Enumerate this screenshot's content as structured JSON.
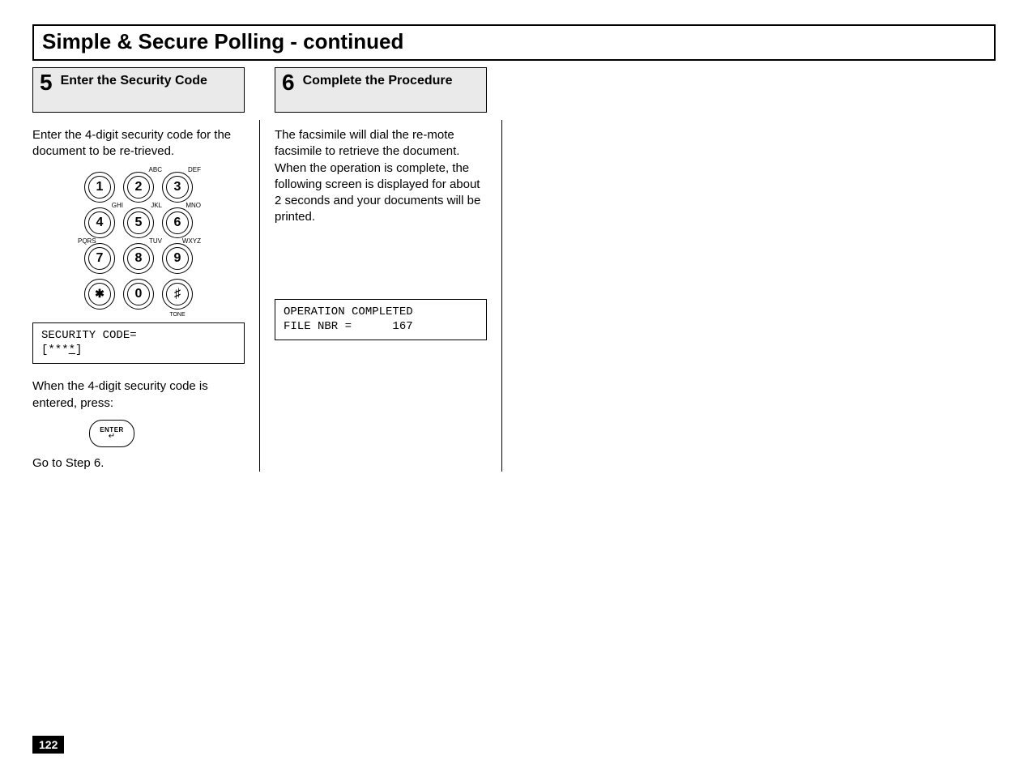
{
  "title": "Simple & Secure Polling - continued",
  "step5": {
    "num": "5",
    "title": "Enter the Security Code",
    "body1": "Enter the 4-digit security code for the document to be re-trieved.",
    "lcd_line1": "SECURITY CODE=",
    "lcd_line2_prefix": "[***",
    "lcd_line2_cursor": "*",
    "lcd_line2_suffix": "]",
    "body2": "When the 4-digit security code is entered, press:",
    "enter_label": "ENTER",
    "enter_arrow": "↵",
    "body3": "Go to Step 6."
  },
  "step6": {
    "num": "6",
    "title": "Complete the Procedure",
    "body1": "The facsimile will dial the re-mote facsimile to retrieve the document. When the operation is complete, the following screen is displayed for about 2 seconds and your documents will be printed.",
    "lcd_line1": "OPERATION COMPLETED",
    "lcd_line2": "FILE NBR =      167"
  },
  "keypad": {
    "labels": {
      "abc": "ABC",
      "def": "DEF",
      "ghi": "GHI",
      "jkl": "JKL",
      "mno": "MNO",
      "pqrs": "PQRS",
      "tuv": "TUV",
      "wxyz": "WXYZ",
      "tone": "TONE"
    },
    "keys": {
      "k1": "1",
      "k2": "2",
      "k3": "3",
      "k4": "4",
      "k5": "5",
      "k6": "6",
      "k7": "7",
      "k8": "8",
      "k9": "9",
      "kstar": "✱",
      "k0": "0",
      "khash": "♯"
    }
  },
  "page_number": "122"
}
